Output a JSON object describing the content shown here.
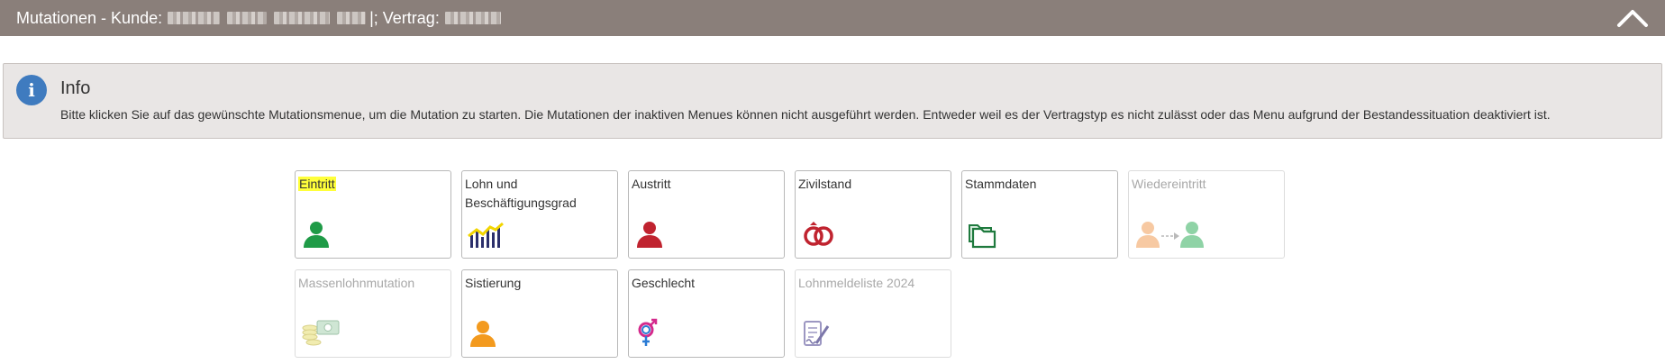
{
  "header": {
    "title_prefix": "Mutationen - Kunde:",
    "contract_label": "|; Vertrag:"
  },
  "info": {
    "title": "Info",
    "text": "Bitte klicken Sie auf das gewünschte Mutationsmenue, um die Mutation zu starten. Die Mutationen der inaktiven Menues können nicht ausgeführt werden. Entweder weil es der Vertragstyp es nicht zulässt oder das Menu aufgrund der Bestandessituation deaktiviert ist."
  },
  "tiles": [
    {
      "label": "Eintritt",
      "icon": "person-green-icon",
      "enabled": true,
      "highlighted": true
    },
    {
      "label": "Lohn und Beschäftigungsgrad",
      "icon": "salary-chart-icon",
      "enabled": true
    },
    {
      "label": "Austritt",
      "icon": "person-red-icon",
      "enabled": true
    },
    {
      "label": "Zivilstand",
      "icon": "rings-icon",
      "enabled": true
    },
    {
      "label": "Stammdaten",
      "icon": "folder-icon",
      "enabled": true
    },
    {
      "label": "Wiedereintritt",
      "icon": "reentry-icon",
      "enabled": false
    },
    {
      "label": "Massenlohnmutation",
      "icon": "money-icon",
      "enabled": false
    },
    {
      "label": "Sistierung",
      "icon": "person-orange-icon",
      "enabled": true
    },
    {
      "label": "Geschlecht",
      "icon": "gender-icon",
      "enabled": true
    },
    {
      "label": "Lohnmeldeliste 2024",
      "icon": "document-sign-icon",
      "enabled": false
    }
  ],
  "colors": {
    "header_bg": "#8a7f7a",
    "info_bg": "#e9e6e5",
    "info_icon": "#3f7bbf",
    "highlight": "#ffff3a"
  }
}
